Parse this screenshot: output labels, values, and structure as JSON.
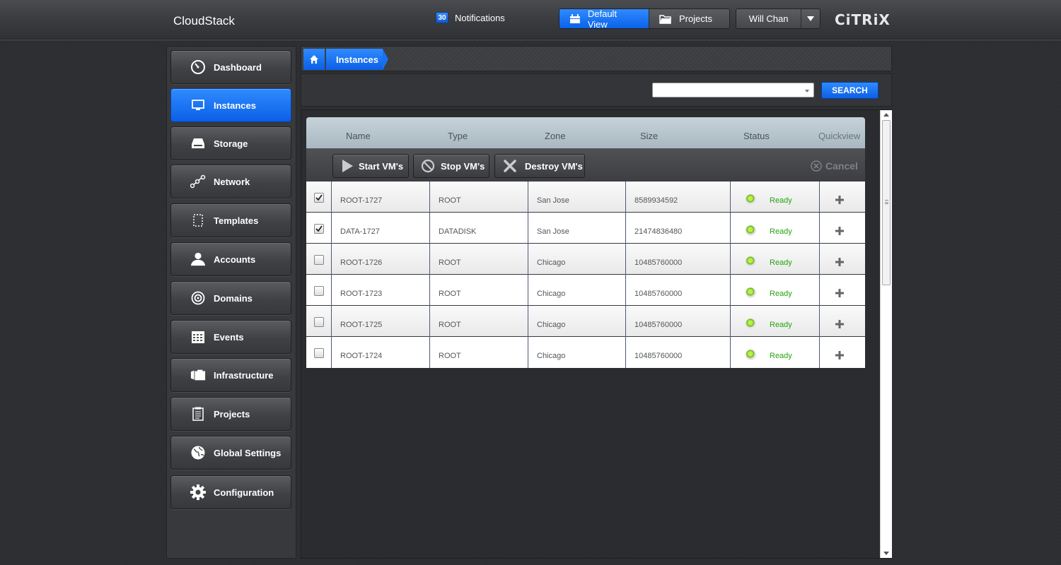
{
  "header": {
    "logo": "CloudStack",
    "notifications": {
      "count": "30",
      "label": "Notifications"
    },
    "views": {
      "default_label": "Default View",
      "projects_label": "Projects"
    },
    "user": {
      "name": "Will Chan"
    },
    "brand": "CiTRiX"
  },
  "sidebar": {
    "items": [
      {
        "label": "Dashboard",
        "icon": "dashboard-icon"
      },
      {
        "label": "Instances",
        "icon": "monitor-icon",
        "active": true
      },
      {
        "label": "Storage",
        "icon": "storage-icon"
      },
      {
        "label": "Network",
        "icon": "network-icon"
      },
      {
        "label": "Templates",
        "icon": "templates-icon"
      },
      {
        "label": "Accounts",
        "icon": "user-icon"
      },
      {
        "label": "Domains",
        "icon": "domains-icon"
      },
      {
        "label": "Events",
        "icon": "calendar-icon"
      },
      {
        "label": "Infrastructure",
        "icon": "infrastructure-icon"
      },
      {
        "label": "Projects",
        "icon": "clipboard-icon"
      },
      {
        "label": "Global Settings",
        "icon": "globe-icon"
      },
      {
        "label": "Configuration",
        "icon": "gear-icon"
      }
    ]
  },
  "breadcrumb": {
    "current": "Instances"
  },
  "toolbar": {
    "search_select_value": "",
    "search_label": "SEARCH"
  },
  "table": {
    "columns": [
      "Name",
      "Type",
      "Zone",
      "Size",
      "Status",
      "Quickview"
    ],
    "actions": {
      "start": "Start VM's",
      "stop": "Stop VM's",
      "destroy": "Destroy VM's",
      "cancel": "Cancel"
    },
    "rows": [
      {
        "checked": true,
        "name": "ROOT-1727",
        "type": "ROOT",
        "zone": "San Jose",
        "size": "8589934592",
        "status": "Ready"
      },
      {
        "checked": true,
        "name": "DATA-1727",
        "type": "DATADISK",
        "zone": "San Jose",
        "size": "21474836480",
        "status": "Ready"
      },
      {
        "checked": false,
        "name": "ROOT-1726",
        "type": "ROOT",
        "zone": "Chicago",
        "size": "10485760000",
        "status": "Ready"
      },
      {
        "checked": false,
        "name": "ROOT-1723",
        "type": "ROOT",
        "zone": "Chicago",
        "size": "10485760000",
        "status": "Ready"
      },
      {
        "checked": false,
        "name": "ROOT-1725",
        "type": "ROOT",
        "zone": "Chicago",
        "size": "10485760000",
        "status": "Ready"
      },
      {
        "checked": false,
        "name": "ROOT-1724",
        "type": "ROOT",
        "zone": "Chicago",
        "size": "10485760000",
        "status": "Ready"
      }
    ]
  },
  "colors": {
    "accent_blue": "#0b62e8",
    "status_ready": "#27a30f",
    "header_bg": "#3a3c40"
  }
}
